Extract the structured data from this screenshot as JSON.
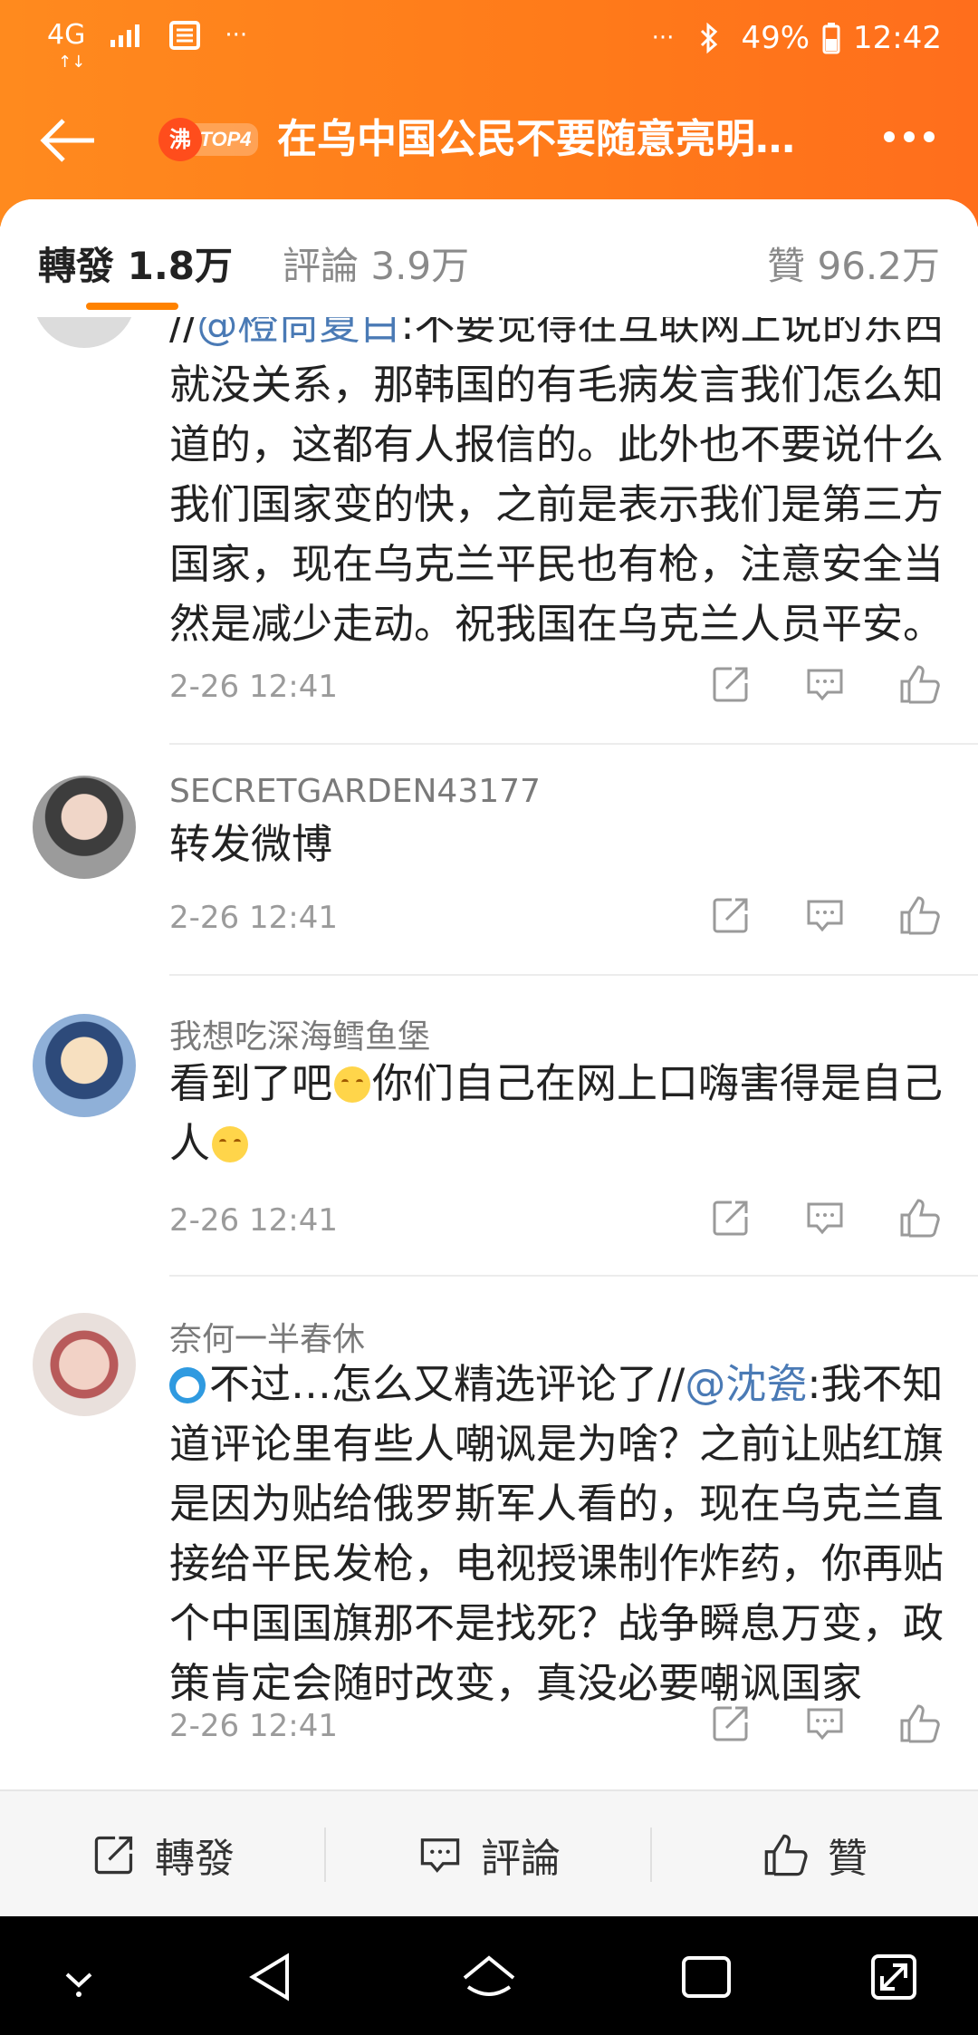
{
  "status_bar": {
    "network": "4G",
    "network_sub": "↑↓",
    "more": "···",
    "dots_right": "···",
    "battery_percent": "49%",
    "time": "12:42"
  },
  "nav": {
    "badge_char": "沸",
    "badge_rank": "TOP4",
    "title": "在乌中国公民不要随意亮明…"
  },
  "tabs": {
    "repost": "轉發 1.8万",
    "comment": "評論 3.9万",
    "like": "贊 96.2万"
  },
  "comments": [
    {
      "content_prefix": "//",
      "mention": "@橙尚夏白",
      "content_rest": ":不要觉得在互联网上说的东西就没关系，那韩国的有毛病发言我们怎么知道的，这都有人报信的。此外也不要说什么我们国家变的快，之前是表示我们是第三方国家，现在乌克兰平民也有枪，注意安全当然是减少走动。祝我国在乌克兰人员平安。",
      "time": "2-26 12:41"
    },
    {
      "username": "SECRETGARDEN43177",
      "content": "转发微博",
      "time": "2-26 12:41"
    },
    {
      "username": "我想吃深海鳕鱼堡",
      "content_a": "看到了吧",
      "content_b": "你们自己在网上口嗨害得是自己人",
      "time": "2-26 12:41"
    },
    {
      "username": "奈何一半春休",
      "content_a": "不过…怎么又精选评论了//",
      "mention": "@沈瓷",
      "content_b": ":我不知道评论里有些人嘲讽是为啥？之前让贴红旗是因为贴给俄罗斯军人看的，现在乌克兰直接给平民发枪，电视授课制作炸药，你再贴个中国国旗那不是找死？战争瞬息万变，政策肯定会随时改变，真没必要嘲讽国家",
      "time": "2-26 12:41"
    }
  ],
  "bottom_bar": {
    "repost": "轉發",
    "comment": "評論",
    "like": "贊"
  },
  "colors": {
    "accent": "#ff8200",
    "header": "#ff7a1a",
    "mention": "#4a7ab5"
  }
}
